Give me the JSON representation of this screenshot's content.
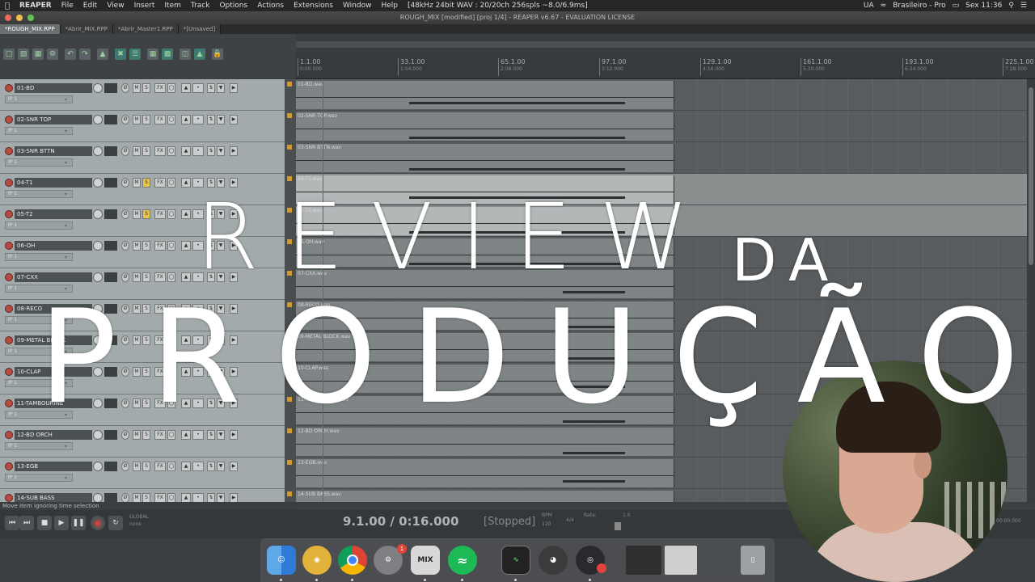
{
  "menubar": {
    "items": [
      "REAPER",
      "File",
      "Edit",
      "View",
      "Insert",
      "Item",
      "Track",
      "Options",
      "Actions",
      "Extensions",
      "Window",
      "Help"
    ],
    "status": "[48kHz 24bit WAV : 20/20ch 256spls ~8.0/6.9ms]",
    "input_source": "UA",
    "keyboard": "Brasileiro - Pro",
    "clock": "Sex 11:36"
  },
  "window": {
    "title": "ROUGH_MIX [modified] [proj 1/4] - REAPER v6.67 - EVALUATION LICENSE"
  },
  "project_tabs": [
    "*ROUGH_MIX.RPP",
    "*Abrir_MIX.RPP",
    "*Abrir_Master1.RPP",
    "*[Unsaved]"
  ],
  "ruler": {
    "marks": [
      {
        "bar": "1.1.00",
        "time": "0:00.000"
      },
      {
        "bar": "33.1.00",
        "time": "1:04.000"
      },
      {
        "bar": "65.1.00",
        "time": "2:08.000"
      },
      {
        "bar": "97.1.00",
        "time": "3:12.000"
      },
      {
        "bar": "129.1.00",
        "time": "4:16.000"
      },
      {
        "bar": "161.1.00",
        "time": "5:20.000"
      },
      {
        "bar": "193.1.00",
        "time": "6:24.000"
      },
      {
        "bar": "225.1.00",
        "time": "7:28.000"
      }
    ]
  },
  "tracks": [
    {
      "name": "01-BD",
      "io": "IP 1",
      "file": "01-BD.wav",
      "solo": false,
      "hl": false
    },
    {
      "name": "02-SNR TOP",
      "io": "IP 1",
      "file": "02-SNR TOP.wav",
      "solo": false,
      "hl": false
    },
    {
      "name": "03-SNR BTTN",
      "io": "IP 1",
      "file": "03-SNR BTTN.wav",
      "solo": false,
      "hl": false
    },
    {
      "name": "04-T1",
      "io": "IP 1",
      "file": "04-T1.wav",
      "solo": true,
      "hl": true
    },
    {
      "name": "05-T2",
      "io": "IP 1",
      "file": "05-T2.wav",
      "solo": true,
      "hl": true
    },
    {
      "name": "06-OH",
      "io": "IP 1",
      "file": "06-OH.wav",
      "solo": false,
      "hl": false
    },
    {
      "name": "07-CXX",
      "io": "IP 1",
      "file": "07-CXX.wav",
      "solo": false,
      "hl": false
    },
    {
      "name": "08-RECO",
      "io": "IP 1",
      "file": "08-RECO.wav",
      "solo": false,
      "hl": false
    },
    {
      "name": "09-METAL BLOCK",
      "io": "IP 1",
      "file": "09-METAL BLOCK.wav",
      "solo": false,
      "hl": false
    },
    {
      "name": "10-CLAP",
      "io": "IP 1",
      "file": "10-CLAP.wav",
      "solo": false,
      "hl": false
    },
    {
      "name": "11-TAMBOURINE",
      "io": "IP 1",
      "file": "11-TAMBOURINE.wav",
      "solo": false,
      "hl": false
    },
    {
      "name": "12-BD ORCH",
      "io": "IP 1",
      "file": "12-BD ORCH.wav",
      "solo": false,
      "hl": false
    },
    {
      "name": "13-EGB",
      "io": "IP 2",
      "file": "13-EGB.wav",
      "solo": false,
      "hl": false
    },
    {
      "name": "14-SUB BASS",
      "io": "IP 1",
      "file": "14-SUB BASS.wav",
      "solo": false,
      "hl": false
    }
  ],
  "status_line": "Move item ignoring time selection",
  "transport": {
    "position": "9.1.00 / 0:16.000",
    "state": "[Stopped]",
    "bpm_label": "BPM",
    "bpm": "120",
    "signature": "4/4",
    "rate_label": "Rate:",
    "rate": "1.0",
    "global": "GLOBAL",
    "auto": "none",
    "duration": "00:00.000"
  },
  "overlay": {
    "line1": "REVIEW",
    "line1b": "DA",
    "line2": "PRODUÇÃO"
  },
  "dock": [
    "Finder",
    "Chrome Canary",
    "Chrome",
    "System Preferences",
    "Mix",
    "Spotify",
    "Activity Monitor",
    "Disk Utility",
    "OBS",
    "Trash"
  ],
  "dock_badge": "1",
  "colors": {
    "track_bg": "#a3aaab",
    "track_name_bg": "#4c5253",
    "solo_on": "#e5c54c",
    "record": "#b74a41",
    "arrange_bg": "#585c5e",
    "overlay_text": "#ffffff"
  }
}
